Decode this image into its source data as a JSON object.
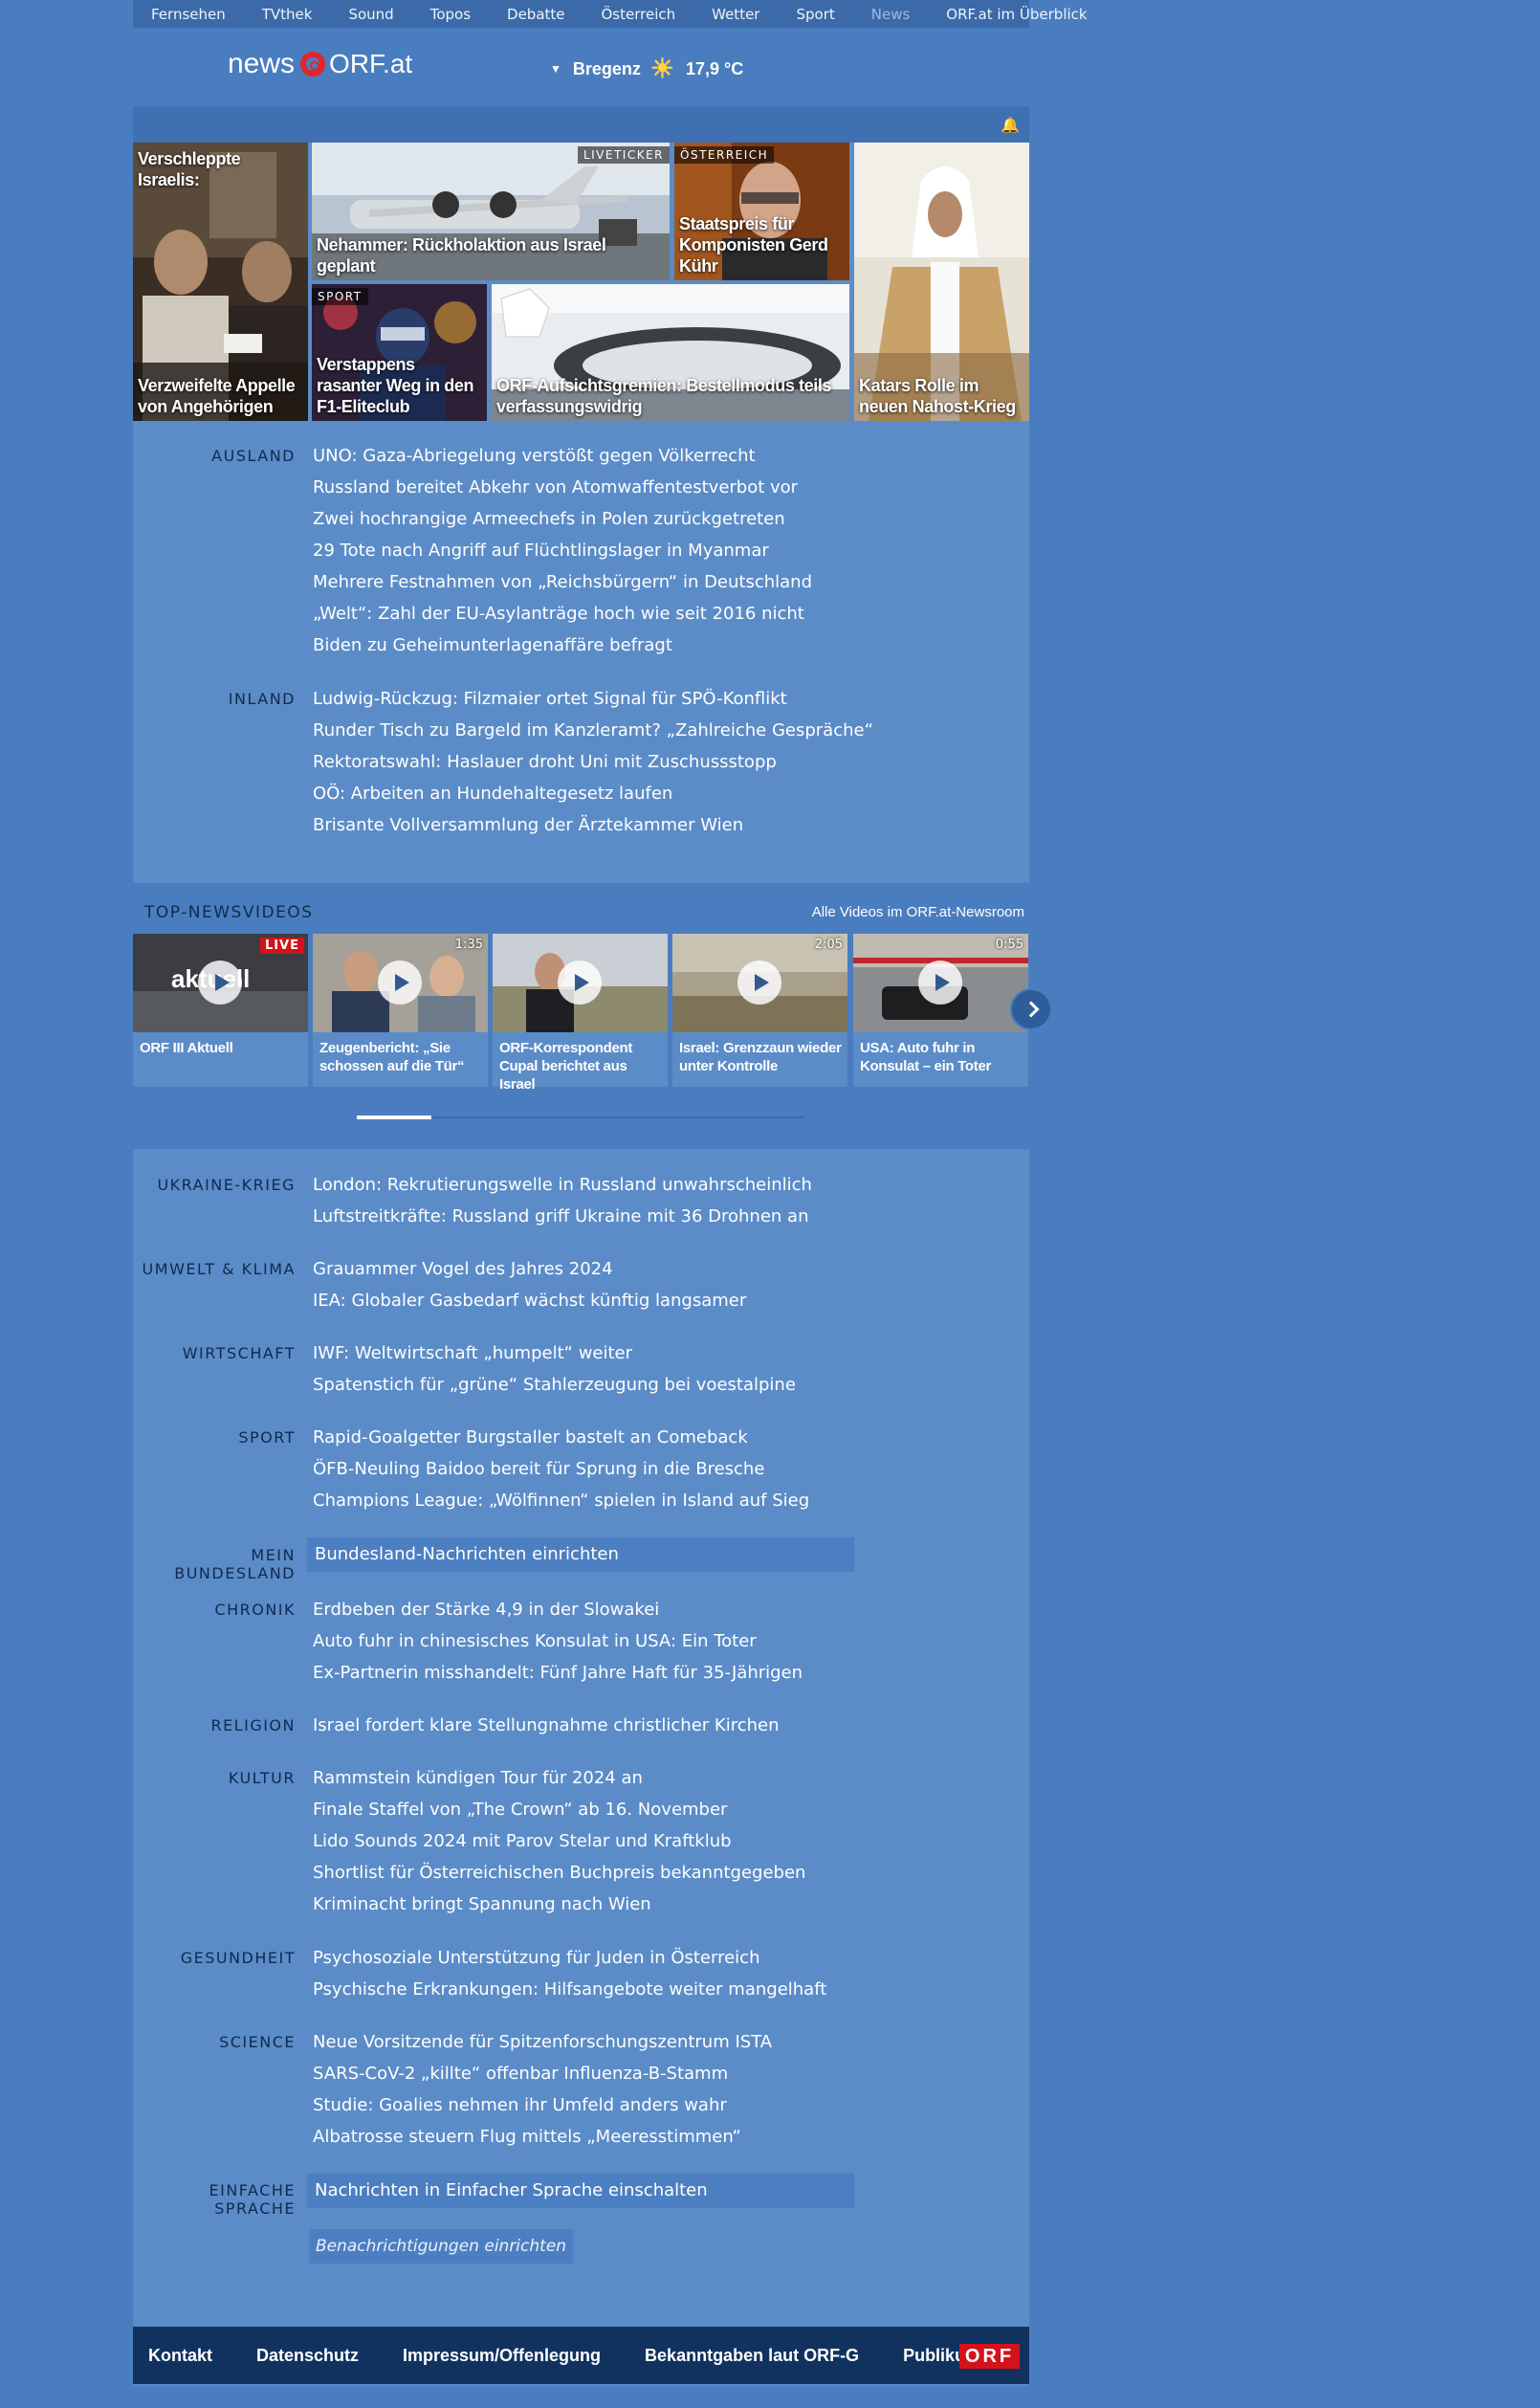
{
  "nav": {
    "items": [
      "Fernsehen",
      "TVthek",
      "Sound",
      "Topos",
      "Debatte",
      "Österreich",
      "Wetter",
      "Sport",
      "News",
      "ORF.at im Überblick"
    ]
  },
  "header": {
    "logo_news": "news",
    "logo_orf": "ORF.at",
    "location": "Bregenz",
    "temperature": "17,9 °C",
    "weather_icon": "sun-icon"
  },
  "teasers": [
    {
      "title": "Verschleppte Israelis:",
      "subtitle": "Verzweifelte Appelle von Angehörigen",
      "tag": ""
    },
    {
      "title": "Nehammer: Rückholaktion aus Israel geplant",
      "tag": "LIVETICKER"
    },
    {
      "title": "Staatspreis für Komponisten Gerd Kühr",
      "tag": "ÖSTERREICH"
    },
    {
      "title": "Katars Rolle im neuen Nahost-Krieg",
      "tag": ""
    },
    {
      "title": "Verstappens rasanter Weg in den F1-Eliteclub",
      "tag": "SPORT"
    },
    {
      "title": "ORF-Aufsichtsgremien: Bestellmodus teils verfassungswidrig",
      "tag": ""
    }
  ],
  "sections_top": [
    {
      "category": "AUSLAND",
      "items": [
        "UNO: Gaza-Abriegelung verstößt gegen Völkerrecht",
        "Russland bereitet Abkehr von Atomwaffentestverbot vor",
        "Zwei hochrangige Armeechefs in Polen zurückgetreten",
        "29 Tote nach Angriff auf Flüchtlingslager in Myanmar",
        "Mehrere Festnahmen von „Reichsbürgern“ in Deutschland",
        "„Welt“: Zahl der EU-Asylanträge hoch wie seit 2016 nicht",
        "Biden zu Geheimunterlagenaffäre befragt"
      ]
    },
    {
      "category": "INLAND",
      "items": [
        "Ludwig-Rückzug: Filzmaier ortet Signal für SPÖ-Konflikt",
        "Runder Tisch zu Bargeld im Kanzleramt? „Zahlreiche Gespräche“",
        "Rektoratswahl: Haslauer droht Uni mit Zuschussstopp",
        "OÖ: Arbeiten an Hundehaltegesetz laufen",
        "Brisante Vollversammlung der Ärztekammer Wien"
      ]
    }
  ],
  "videos": {
    "heading": "TOP-NEWSVIDEOS",
    "all_link": "Alle Videos im ORF.at-Newsroom",
    "items": [
      {
        "title": "ORF III Aktuell",
        "duration": "",
        "live": "LIVE",
        "thumb_text": "aktuell"
      },
      {
        "title": "Zeugenbericht: „Sie schossen auf die Tür“",
        "duration": "1:35",
        "live": ""
      },
      {
        "title": "ORF-Korrespondent Cupal berichtet aus Israel",
        "duration": "",
        "live": ""
      },
      {
        "title": "Israel: Grenzzaun wieder unter Kontrolle",
        "duration": "2:05",
        "live": ""
      },
      {
        "title": "USA: Auto fuhr in Konsulat – ein Toter",
        "duration": "0:55",
        "live": ""
      }
    ]
  },
  "sections_bottom": [
    {
      "category": "UKRAINE-KRIEG",
      "items": [
        "London: Rekrutierungswelle in Russland unwahrscheinlich",
        "Luftstreitkräfte: Russland griff Ukraine mit 36 Drohnen an"
      ]
    },
    {
      "category": "UMWELT & KLIMA",
      "items": [
        "Grauammer Vogel des Jahres 2024",
        "IEA: Globaler Gasbedarf wächst künftig langsamer"
      ]
    },
    {
      "category": "WIRTSCHAFT",
      "items": [
        "IWF: Weltwirtschaft „humpelt“ weiter",
        "Spatenstich für „grüne“ Stahlerzeugung bei voestalpine"
      ]
    },
    {
      "category": "SPORT",
      "items": [
        "Rapid-Goalgetter Burgstaller bastelt an Comeback",
        "ÖFB-Neuling Baidoo bereit für Sprung in die Bresche",
        "Champions League: „Wölfinnen“ spielen in Island auf Sieg"
      ]
    },
    {
      "category": "MEIN BUNDESLAND",
      "setup": "Bundesland-Nachrichten einrichten"
    },
    {
      "category": "CHRONIK",
      "items": [
        "Erdbeben der Stärke 4,9 in der Slowakei",
        "Auto fuhr in chinesisches Konsulat in USA: Ein Toter",
        "Ex-Partnerin misshandelt: Fünf Jahre Haft für 35-Jährigen"
      ]
    },
    {
      "category": "RELIGION",
      "items": [
        "Israel fordert klare Stellungnahme christlicher Kirchen"
      ]
    },
    {
      "category": "KULTUR",
      "items": [
        "Rammstein kündigen Tour für 2024 an",
        "Finale Staffel von „The Crown“ ab 16. November",
        "Lido Sounds 2024 mit Parov Stelar und Kraftklub",
        "Shortlist für Österreichischen Buchpreis bekanntgegeben",
        "Kriminacht bringt Spannung nach Wien"
      ]
    },
    {
      "category": "GESUNDHEIT",
      "items": [
        "Psychosoziale Unterstützung für Juden in Österreich",
        "Psychische Erkrankungen: Hilfsangebote weiter mangelhaft"
      ]
    },
    {
      "category": "SCIENCE",
      "items": [
        "Neue Vorsitzende für Spitzenforschungszentrum ISTA",
        "SARS-CoV-2 „killte“ offenbar Influenza-B-Stamm",
        "Studie: Goalies nehmen ihr Umfeld anders wahr",
        "Albatrosse steuern Flug mittels „Meeresstimmen“"
      ]
    },
    {
      "category": "EINFACHE SPRACHE",
      "setup": "Nachrichten in Einfacher Sprache einschalten"
    }
  ],
  "notification_button": "Benachrichtigungen einrichten",
  "footer": {
    "links": [
      "Kontakt",
      "Datenschutz",
      "Impressum/Offenlegung",
      "Bekanntgaben laut ORF-G",
      "Publikumsrat"
    ],
    "badge": "ORF"
  }
}
